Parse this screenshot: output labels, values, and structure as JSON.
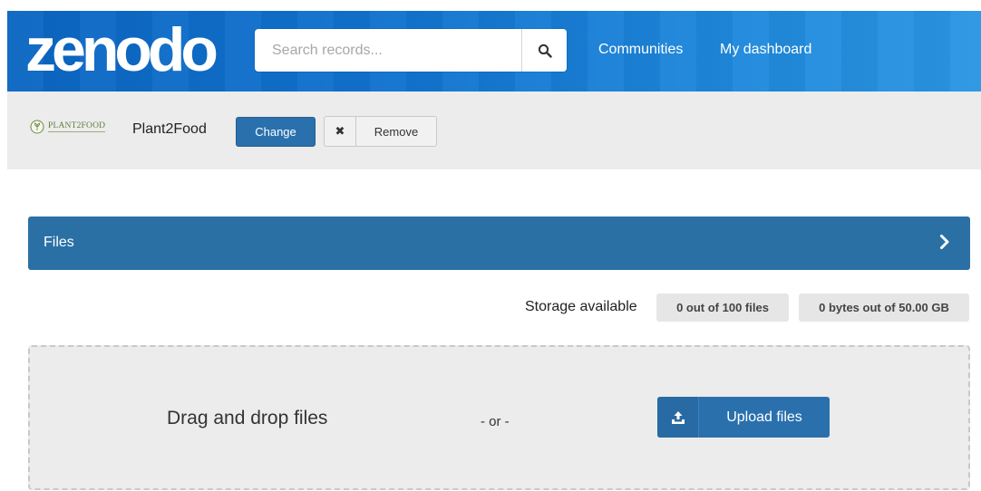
{
  "header": {
    "logo_text": "zenodo",
    "search": {
      "placeholder": "Search records...",
      "icon": "search-icon"
    },
    "nav": [
      "Communities",
      "My dashboard"
    ]
  },
  "community": {
    "logo_text": "PLANT2FOOD",
    "name": "Plant2Food",
    "change_label": "Change",
    "remove_label": "Remove"
  },
  "files": {
    "title": "Files",
    "storage_label": "Storage available",
    "files_count": "0 out of 100 files",
    "bytes": "0 bytes out of 50.00 GB",
    "drag_text": "Drag and drop files",
    "or_text": "- or -",
    "upload_label": "Upload files"
  },
  "colors": {
    "header_blue": "#1173cf",
    "primary_button": "#2a70ad",
    "panel_blue": "#2a70a5",
    "light_gray": "#ececec"
  }
}
